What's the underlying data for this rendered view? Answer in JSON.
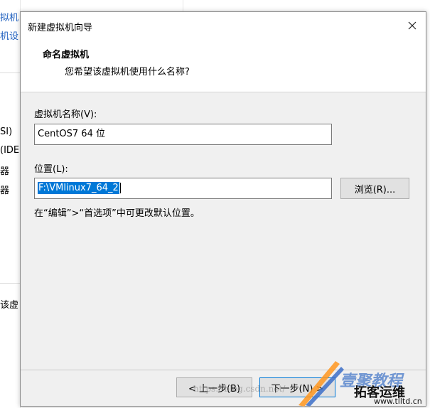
{
  "background": {
    "lines": [
      {
        "text": "拟机",
        "color": "#1e5fbf"
      },
      {
        "text": "机设",
        "color": "#1e5fbf"
      },
      {
        "text": "SI)",
        "color": "#000000"
      },
      {
        "text": "(IDE)",
        "color": "#000000"
      },
      {
        "text": "器",
        "color": "#000000"
      },
      {
        "text": "器",
        "color": "#000000"
      },
      {
        "text": "该虚",
        "color": "#000000"
      }
    ]
  },
  "dialog": {
    "title": "新建虚拟机向导",
    "close_icon": "close-icon",
    "header": {
      "title": "命名虚拟机",
      "subtitle": "您希望该虚拟机使用什么名称?"
    },
    "name_field": {
      "label": "虚拟机名称(V):",
      "value": "CentOS7 64 位"
    },
    "location_field": {
      "label": "位置(L):",
      "value": "F:\\VMlinux7_64_2"
    },
    "browse_label": "浏览(R)...",
    "hint": "在“编辑”>“首选项”中可更改默认位置。",
    "buttons": {
      "back": "< 上一步(B)",
      "next": "下一步(N) >"
    }
  },
  "watermark": {
    "url": "https://blog.csdn.net/",
    "logo_line1": "壹聚教程",
    "logo_line2": "拓客运维",
    "logo_url": "www.tlltd.cn"
  },
  "colors": {
    "selection": "#0078d7",
    "dialog_bg": "#f0f0f0",
    "link_blue": "#1e5fbf"
  }
}
